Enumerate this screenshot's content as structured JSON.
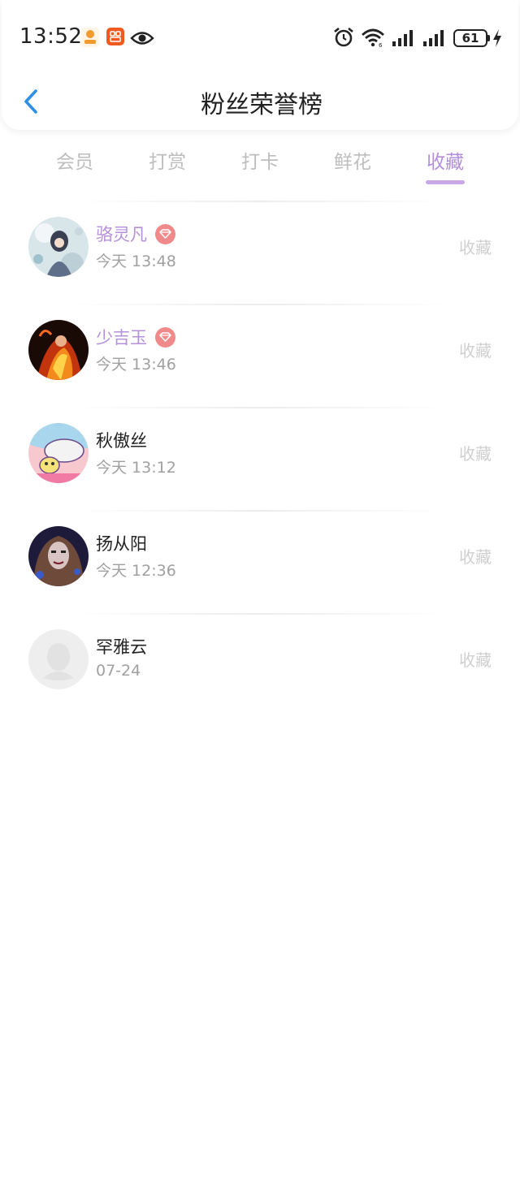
{
  "status_bar": {
    "time": "13:52",
    "battery": "61",
    "icons": [
      "app-icon",
      "app-icon",
      "eye-icon",
      "alarm-icon",
      "wifi-icon",
      "signal-icon",
      "signal-icon",
      "charging-icon"
    ]
  },
  "header": {
    "title": "粉丝荣誉榜",
    "back_icon": "chevron-left-icon"
  },
  "tabs": [
    {
      "label": "会员",
      "active": false
    },
    {
      "label": "打赏",
      "active": false
    },
    {
      "label": "打卡",
      "active": false
    },
    {
      "label": "鲜花",
      "active": false
    },
    {
      "label": "收藏",
      "active": true
    }
  ],
  "colors": {
    "accent": "#b38fdb",
    "vip_name": "#b58fd8",
    "vip_badge": "#f08a8a",
    "muted": "#a0a0a0",
    "back_arrow": "#2f8fe6"
  },
  "fans": [
    {
      "name": "骆灵凡",
      "vip": true,
      "time": "今天 13:48",
      "action": "收藏"
    },
    {
      "name": "少吉玉",
      "vip": true,
      "time": "今天 13:46",
      "action": "收藏"
    },
    {
      "name": "秋傲丝",
      "vip": false,
      "time": "今天 13:12",
      "action": "收藏"
    },
    {
      "name": "扬从阳",
      "vip": false,
      "time": "今天 12:36",
      "action": "收藏"
    },
    {
      "name": "罕雅云",
      "vip": false,
      "time": "07-24",
      "action": "收藏"
    }
  ]
}
